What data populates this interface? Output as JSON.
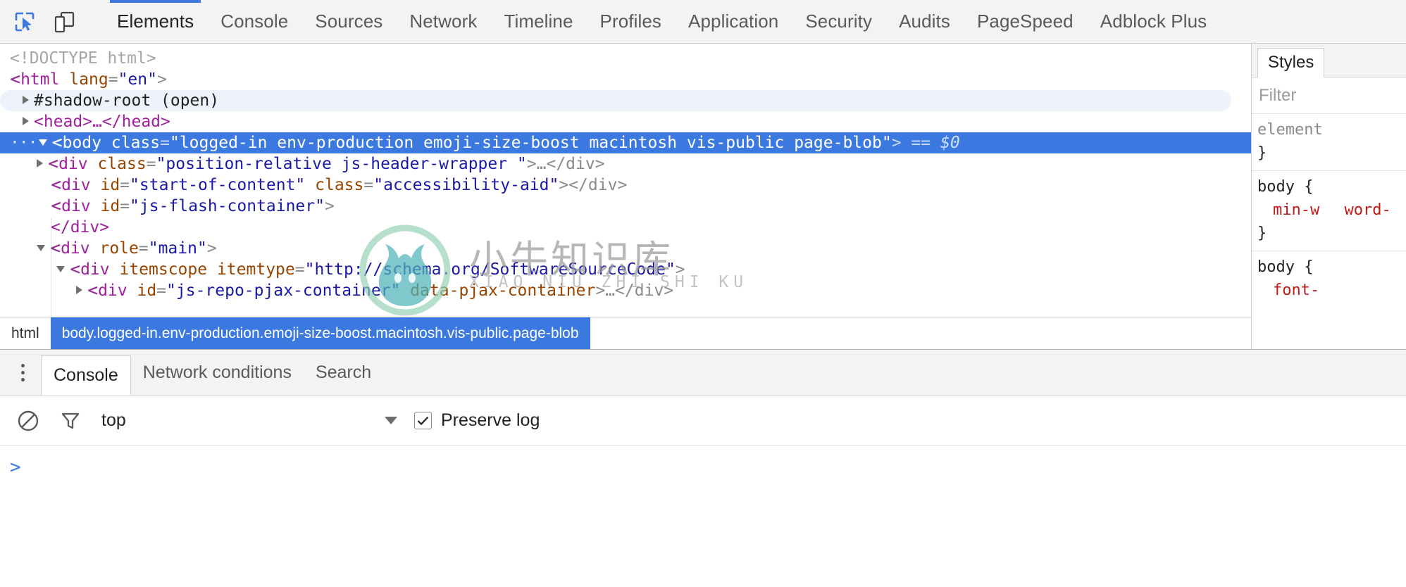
{
  "toolbar": {
    "inspect_icon": "inspect-cursor-icon",
    "device_icon": "device-toolbar-icon",
    "tabs": [
      {
        "label": "Elements",
        "active": true
      },
      {
        "label": "Console",
        "active": false
      },
      {
        "label": "Sources",
        "active": false
      },
      {
        "label": "Network",
        "active": false
      },
      {
        "label": "Timeline",
        "active": false
      },
      {
        "label": "Profiles",
        "active": false
      },
      {
        "label": "Application",
        "active": false
      },
      {
        "label": "Security",
        "active": false
      },
      {
        "label": "Audits",
        "active": false
      },
      {
        "label": "PageSpeed",
        "active": false
      },
      {
        "label": "Adblock Plus",
        "active": false
      }
    ]
  },
  "dom": {
    "doctype": "<!DOCTYPE html>",
    "html_open_tag": "<html",
    "html_attr_name": "lang",
    "html_attr_value": "\"en\"",
    "html_close_bracket": ">",
    "shadow_root": "#shadow-root (open)",
    "head_row": "<head>…</head>",
    "body": {
      "dots": "···",
      "open": "<body",
      "attr": "class",
      "value": "\"logged-in env-production emoji-size-boost macintosh vis-public page-blob\"",
      "close": ">",
      "eq": "==",
      "dollar": "$0"
    },
    "children": [
      {
        "tag": "<div",
        "attr1": "class",
        "val1": "\"position-relative js-header-wrapper \"",
        "tail": ">…</div>",
        "arrow": "closed",
        "indent": 2
      },
      {
        "tag": "<div",
        "attr1": "id",
        "val1": "\"start-of-content\"",
        "attr2": "class",
        "val2": "\"accessibility-aid\"",
        "tail": "></div>",
        "arrow": "none",
        "indent": 2
      },
      {
        "tag": "<div",
        "attr1": "id",
        "val1": "\"js-flash-container\"",
        "tail": ">",
        "arrow": "none",
        "indent": 2
      },
      {
        "tag": "</div>",
        "arrow": "none",
        "indent": 2,
        "closeonly": true
      },
      {
        "tag": "<div",
        "attr1": "role",
        "val1": "\"main\"",
        "tail": ">",
        "arrow": "open",
        "indent": 2
      },
      {
        "tag": "<div",
        "attr1": "itemscope",
        "attr2": "itemtype",
        "val2": "\"http://schema.org/SoftwareSourceCode\"",
        "tail": ">",
        "arrow": "open",
        "indent": 3
      },
      {
        "tag": "<div",
        "attr1": "id",
        "val1": "\"js-repo-pjax-container\"",
        "attr2": "data-pjax-container",
        "tail": ">…</div>",
        "arrow": "closed",
        "indent": 4
      }
    ]
  },
  "breadcrumb": {
    "items": [
      {
        "label": "html",
        "active": false
      },
      {
        "label": "body.logged-in.env-production.emoji-size-boost.macintosh.vis-public.page-blob",
        "active": true
      }
    ]
  },
  "styles": {
    "tab_label": "Styles",
    "filter_placeholder": "Filter",
    "rules": [
      {
        "selector": "element",
        "selector_style": "gray",
        "declarations": [],
        "close": "}"
      },
      {
        "selector": "body {",
        "selector_style": "dark",
        "declarations": [
          "min-w",
          "word-"
        ],
        "close": "}"
      },
      {
        "selector": "body {",
        "selector_style": "dark",
        "declarations": [
          "font-"
        ],
        "close": ""
      }
    ]
  },
  "drawer": {
    "menu_icon": "kebab-menu-icon",
    "tabs": [
      {
        "label": "Console",
        "active": true
      },
      {
        "label": "Network conditions",
        "active": false
      },
      {
        "label": "Search",
        "active": false
      }
    ],
    "console_toolbar": {
      "clear_icon": "clear-console-icon",
      "filter_icon": "filter-funnel-icon",
      "context_value": "top",
      "dropdown_icon": "chevron-down-icon",
      "preserve_log_label": "Preserve log",
      "preserve_log_checked": true
    },
    "prompt_symbol": ">",
    "input_value": ""
  },
  "watermark": {
    "logo_icon": "ox-head-logo-icon",
    "chinese_text": "小牛知识库",
    "pinyin_text": "XIAO NIU ZHI SHI KU"
  },
  "colors": {
    "accent_blue": "#3b79e0",
    "tag_purple": "#a0209e",
    "attr_brown": "#994500",
    "value_blue": "#1a1aa6",
    "css_prop_red": "#c41a16",
    "toolbar_bg": "#f3f3f3"
  }
}
